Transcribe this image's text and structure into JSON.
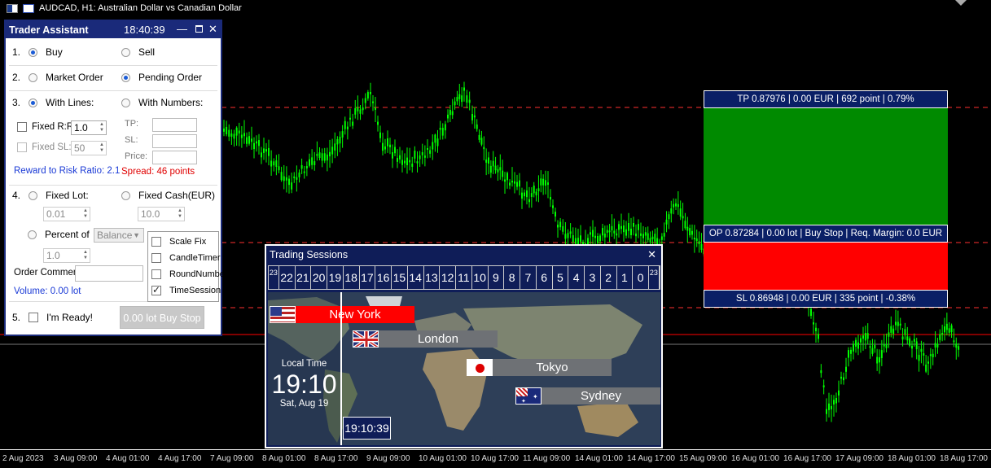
{
  "chart": {
    "symbol_title": "AUDCAD, H1:  Australian Dollar vs Canadian  Dollar",
    "x_labels": [
      "2 Aug 2023",
      "3 Aug 09:00",
      "4 Aug 01:00",
      "4 Aug 17:00",
      "7 Aug 09:00",
      "8 Aug 01:00",
      "8 Aug 17:00",
      "9 Aug 09:00",
      "10 Aug 01:00",
      "10 Aug 17:00",
      "11 Aug 09:00",
      "14 Aug 01:00",
      "14 Aug 17:00",
      "15 Aug 09:00",
      "16 Aug 01:00",
      "16 Aug 17:00",
      "17 Aug 09:00",
      "18 Aug 01:00",
      "18 Aug 17:00"
    ],
    "candle_color": "#00ff00",
    "line_colors": {
      "dashed": "#ff3030",
      "solid": "#ff0000",
      "grey": "#777777"
    }
  },
  "position": {
    "tp_label": "TP 0.87976  |  0.00 EUR  |  692 point  |  0.79%",
    "op_label": "OP 0.87284 | 0.00 lot | Buy Stop | Req. Margin: 0.0 EUR",
    "sl_label": "SL 0.86948  |  0.00 EUR  |  335 point  |  -0.38%",
    "tp_color": "#008a00",
    "sl_color": "#ff0000"
  },
  "trader_assistant": {
    "title": "Trader Assistant",
    "clock": "18:40:39",
    "minimize": "—",
    "close": "✕",
    "step1": "1.",
    "buy": "Buy",
    "sell": "Sell",
    "step2": "2.",
    "market_order": "Market Order",
    "pending_order": "Pending Order",
    "step3": "3.",
    "with_lines": "With Lines:",
    "with_numbers": "With Numbers:",
    "fixed_rr_label": "Fixed R:R",
    "fixed_rr_value": "1.0",
    "fixed_sl_label": "Fixed SL:",
    "fixed_sl_value": "50",
    "tp_label": "TP:",
    "sl_label": "SL:",
    "price_label": "Price:",
    "rr_ratio": "Reward to Risk Ratio: 2.1",
    "spread": "Spread: 46 points",
    "step4": "4.",
    "fixed_lot": "Fixed Lot:",
    "fixed_cash": "Fixed Cash(EUR)",
    "lot_value": "0.01",
    "cash_value": "10.0",
    "percent_of": "Percent of",
    "balance": "Balance",
    "percent_value": "1.0",
    "order_comment": "Order Comment:",
    "volume": "Volume: 0.00 lot",
    "step5": "5.",
    "ready": "I'm Ready!",
    "submit": "0.00 lot  Buy Stop",
    "options": [
      {
        "label": "Scale Fix",
        "checked": false
      },
      {
        "label": "CandleTimer",
        "checked": false
      },
      {
        "label": "RoundNumber",
        "checked": false
      },
      {
        "label": "TimeSession",
        "checked": true
      }
    ]
  },
  "sessions": {
    "title": "Trading Sessions",
    "close": "✕",
    "hours": [
      "23",
      "22",
      "21",
      "20",
      "19",
      "18",
      "17",
      "16",
      "15",
      "14",
      "13",
      "12",
      "11",
      "10",
      "9",
      "8",
      "7",
      "6",
      "5",
      "4",
      "3",
      "2",
      "1",
      "0",
      "23"
    ],
    "new_york": "New York",
    "london": "London",
    "tokyo": "Tokyo",
    "sydney": "Sydney",
    "local_time_label": "Local Time",
    "local_time": "19:10",
    "local_date": "Sat, Aug 19",
    "current_time": "19:10:39"
  }
}
